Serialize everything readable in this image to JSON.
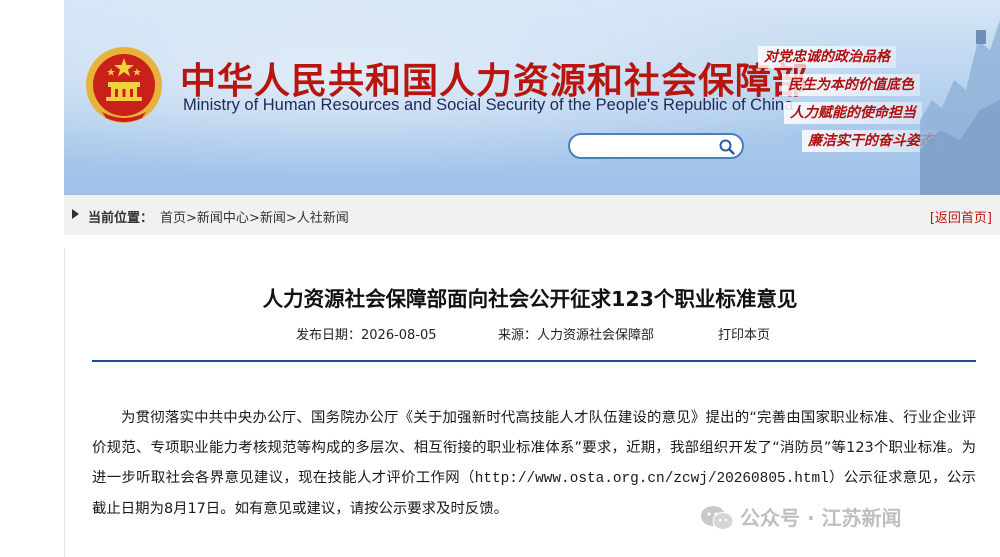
{
  "header": {
    "ministry_cn": "中华人民共和国人力资源和社会保障部",
    "ministry_en": "Ministry of Human Resources and Social Security of the People's Republic of China",
    "slogans": [
      "对党忠诚的政治品格",
      "民生为本的价值底色",
      "人力赋能的使命担当",
      "廉洁实干的奋斗姿态"
    ],
    "search": {
      "placeholder": "",
      "value": ""
    },
    "colors": {
      "title_red": "#b7150e",
      "banner_blue": "#a9c8eb",
      "search_border": "#4d7fb8"
    }
  },
  "breadcrumb": {
    "label": "当前位置：",
    "items": [
      "首页",
      "新闻中心",
      "新闻",
      "人社新闻"
    ],
    "separator": ">",
    "back_label": "[返回首页]"
  },
  "article": {
    "title": "人力资源社会保障部面向社会公开征求123个职业标准意见",
    "publish_date": "发布日期：2026-08-05",
    "source": "来源：人力资源社会保障部",
    "print": "打印本页",
    "body_before_url": "为贯彻落实中共中央办公厅、国务院办公厅《关于加强新时代高技能人才队伍建设的意见》提出的“完善由国家职业标准、行业企业评价规范、专项职业能力考核规范等构成的多层次、相互衔接的职业标准体系”要求，近期，我部组织开发了“消防员”等123个职业标准。为进一步听取社会各界意见建议，现在技能人才评价工作网（",
    "body_url": "http://www.osta.org.cn/zcwj/20260805.html",
    "body_after_url": "）公示征求意见，公示截止日期为8月17日。如有意见或建议，请按公示要求及时反馈。"
  },
  "watermark": {
    "text": "公众号 · 江苏新闻",
    "icon": "wechat-icon"
  }
}
